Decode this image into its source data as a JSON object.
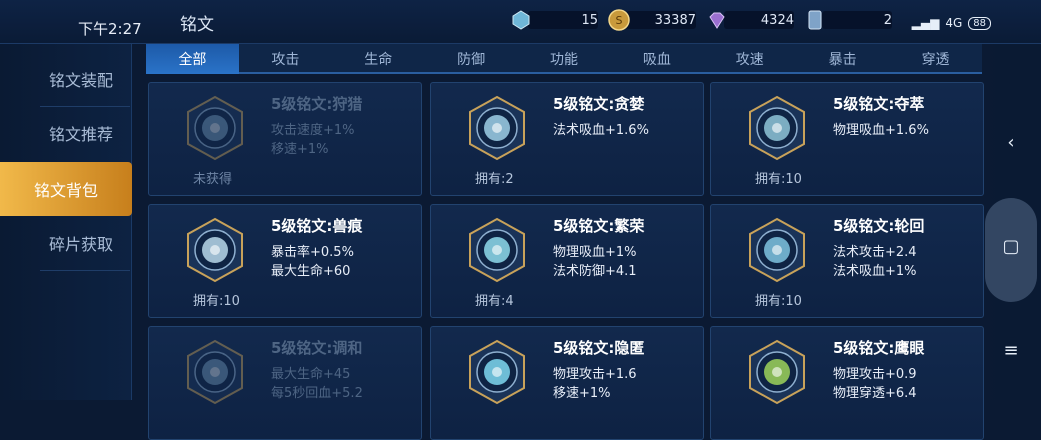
{
  "status": {
    "time": "下午2:27",
    "network": "4G",
    "battery": "88"
  },
  "header": {
    "title": "铭文",
    "resources": [
      {
        "icon": "crystal-icon",
        "value": "15",
        "color": "#6fb7d8"
      },
      {
        "icon": "gold-coin-icon",
        "value": "33387",
        "color": "#c89a3c"
      },
      {
        "icon": "diamond-icon",
        "value": "4324",
        "color": "#9a6fd0"
      },
      {
        "icon": "card-icon",
        "value": "2",
        "color": "#7fa3c8"
      }
    ]
  },
  "sidebar": {
    "items": [
      {
        "label": "铭文装配"
      },
      {
        "label": "铭文推荐"
      },
      {
        "label": "铭文背包"
      },
      {
        "label": "碎片获取"
      }
    ],
    "active_index": 2
  },
  "tabs": [
    "全部",
    "攻击",
    "生命",
    "防御",
    "功能",
    "吸血",
    "攻速",
    "暴击",
    "穿透"
  ],
  "active_tab": 0,
  "cards": [
    {
      "name": "5级铭文:狩猎",
      "stats": [
        "攻击速度+1%",
        "移速+1%"
      ],
      "own": "未获得",
      "dim": true,
      "gem": "#7fa8c8"
    },
    {
      "name": "5级铭文:贪婪",
      "stats": [
        "法术吸血+1.6%"
      ],
      "own": "拥有:2",
      "dim": false,
      "gem": "#9fd0e8"
    },
    {
      "name": "5级铭文:夺萃",
      "stats": [
        "物理吸血+1.6%"
      ],
      "own": "拥有:10",
      "dim": false,
      "gem": "#8fc6d8"
    },
    {
      "name": "5级铭文:兽痕",
      "stats": [
        "暴击率+0.5%",
        "最大生命+60"
      ],
      "own": "拥有:10",
      "dim": false,
      "gem": "#b8d8ea"
    },
    {
      "name": "5级铭文:繁荣",
      "stats": [
        "物理吸血+1%",
        "法术防御+4.1"
      ],
      "own": "拥有:4",
      "dim": false,
      "gem": "#8fdcec"
    },
    {
      "name": "5级铭文:轮回",
      "stats": [
        "法术攻击+2.4",
        "法术吸血+1%"
      ],
      "own": "拥有:10",
      "dim": false,
      "gem": "#7fc4e0"
    },
    {
      "name": "5级铭文:调和",
      "stats": [
        "最大生命+45",
        "每5秒回血+5.2"
      ],
      "own": "",
      "dim": true,
      "gem": "#7fa8c8"
    },
    {
      "name": "5级铭文:隐匿",
      "stats": [
        "物理攻击+1.6",
        "移速+1%"
      ],
      "own": "",
      "dim": false,
      "gem": "#7fd8f0"
    },
    {
      "name": "5级铭文:鹰眼",
      "stats": [
        "物理攻击+0.9",
        "物理穿透+6.4"
      ],
      "own": "",
      "dim": false,
      "gem": "#9ed45a"
    }
  ],
  "nav": {
    "back": "‹",
    "home": "▢",
    "menu": "≡"
  }
}
